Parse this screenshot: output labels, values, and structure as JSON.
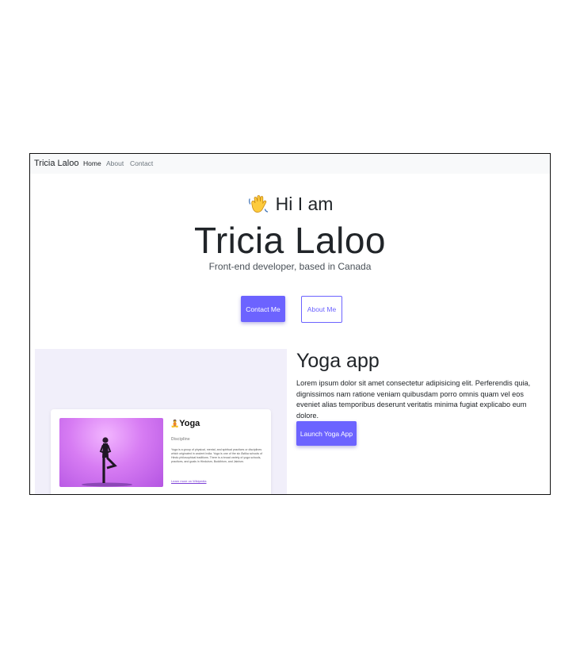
{
  "nav": {
    "brand": "Tricia Laloo",
    "links": [
      {
        "label": "Home",
        "active": true
      },
      {
        "label": "About",
        "active": false
      },
      {
        "label": "Contact",
        "active": false
      }
    ]
  },
  "hero": {
    "greeting_icon": "waving-hand-icon",
    "greeting": "Hi I am",
    "name": "Tricia Laloo",
    "subtitle": "Front-end developer, based in Canada",
    "primary_button": "Contact Me",
    "secondary_button": "About Me"
  },
  "project": {
    "title": "Yoga app",
    "description": "Lorem ipsum dolor sit amet consectetur adipisicing elit. Perferendis quia, dignissimos nam ratione veniam quibusdam porro omnis quam vel eos eveniet alias temporibus deserunt veritatis minima fugiat explicabo eum dolore.",
    "button": "Launch Yoga App",
    "preview": {
      "icon": "meditation-icon",
      "title": "Yoga",
      "kicker": "Discipline",
      "text": "Yoga is a group of physical, mental, and spiritual practices or disciplines which originated in ancient India. Yoga is one of the six Āstika schools of Hindu philosophical traditions. There is a broad variety of yoga schools, practices, and goals in Hinduism, Buddhism, and Jainism.",
      "link": "Learn more on Wikipedia"
    }
  },
  "colors": {
    "accent": "#6c63ff",
    "navbar_bg": "#f8f9fa",
    "preview_bg": "#f1effa",
    "text": "#212529"
  }
}
